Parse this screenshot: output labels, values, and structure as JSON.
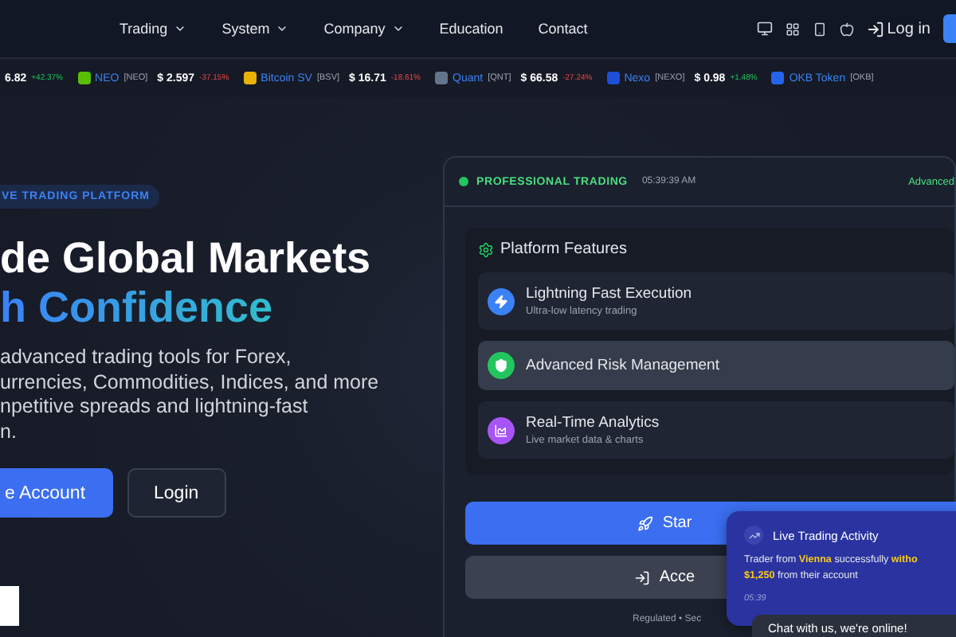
{
  "nav": {
    "items": [
      {
        "label": "Trading",
        "dropdown": true
      },
      {
        "label": "System",
        "dropdown": true
      },
      {
        "label": "Company",
        "dropdown": true
      },
      {
        "label": "Education",
        "dropdown": false
      },
      {
        "label": "Contact",
        "dropdown": false
      }
    ],
    "login": "Log in"
  },
  "ticker": [
    {
      "price": "6.82",
      "change": "+42.37%",
      "rising": true
    },
    {
      "name": "NEO",
      "symbol": "[NEO]",
      "price": "$ 2.597",
      "change": "-37.15%",
      "rising": false,
      "color": "#58bf00"
    },
    {
      "name": "Bitcoin SV",
      "symbol": "[BSV]",
      "price": "$ 16.71",
      "change": "-18.61%",
      "rising": false,
      "color": "#eab308"
    },
    {
      "name": "Quant",
      "symbol": "[QNT]",
      "price": "$ 66.58",
      "change": "-27.24%",
      "rising": false,
      "color": "#64748b"
    },
    {
      "name": "Nexo",
      "symbol": "[NEXO]",
      "price": "$ 0.98",
      "change": "+1.48%",
      "rising": true,
      "color": "#1e4fd8"
    },
    {
      "name": "OKB Token",
      "symbol": "[OKB]",
      "color": "#2563eb"
    }
  ],
  "hero": {
    "badge": "VE TRADING PLATFORM",
    "title_lines": [
      "de Global Markets",
      "h Confidence"
    ],
    "description_lines": [
      "advanced trading tools for Forex,",
      "urrencies, Commodities, Indices, and more",
      "npetitive spreads and lightning-fast",
      "n."
    ],
    "buttons": [
      {
        "label": "e Account",
        "kind": "primary"
      },
      {
        "label": "Login",
        "kind": "secondary"
      }
    ]
  },
  "panel": {
    "status": "PROFESSIONAL TRADING",
    "time": "05:39:39 AM",
    "mode": "Advanced",
    "features_title": "Platform Features",
    "features": [
      {
        "title": "Lightning Fast Execution",
        "subtitle": "Ultra-low latency trading",
        "kind": "bolt",
        "color": "#3b82f6",
        "selected": false
      },
      {
        "title": "Advanced Risk Management",
        "kind": "shield",
        "color": "#22c55e",
        "selected": true
      },
      {
        "title": "Real-Time Analytics",
        "subtitle": "Live market data & charts",
        "kind": "chart",
        "color": "#a855f7",
        "selected": false
      }
    ],
    "buttons": [
      {
        "label": "Star",
        "kind": "primary"
      },
      {
        "label": "Acce",
        "kind": "secondary"
      }
    ],
    "footer": "Regulated • Sec"
  },
  "activity": {
    "title": "Live Trading Activity",
    "message_lines": [
      "Trader from **Vienna** successfully **witho**",
      "**$1,250** from their account"
    ],
    "time": "05:39"
  },
  "chat": {
    "label": "Chat with us, we're online!"
  }
}
